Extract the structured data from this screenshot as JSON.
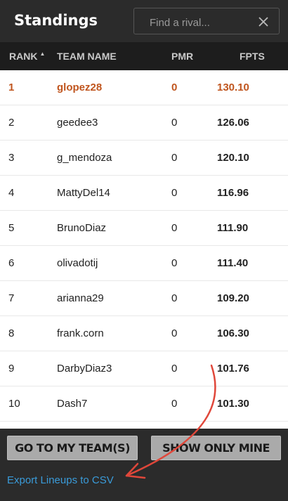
{
  "header": {
    "title": "Standings",
    "search_placeholder": "Find a rival..."
  },
  "columns": {
    "rank": "RANK",
    "team": "TEAM NAME",
    "pmr": "PMR",
    "fpts": "FPTS"
  },
  "rows": [
    {
      "rank": "1",
      "team": "glopez28",
      "pmr": "0",
      "fpts": "130.10",
      "highlight": true
    },
    {
      "rank": "2",
      "team": "geedee3",
      "pmr": "0",
      "fpts": "126.06"
    },
    {
      "rank": "3",
      "team": "g_mendoza",
      "pmr": "0",
      "fpts": "120.10"
    },
    {
      "rank": "4",
      "team": "MattyDel14",
      "pmr": "0",
      "fpts": "116.96"
    },
    {
      "rank": "5",
      "team": "BrunoDiaz",
      "pmr": "0",
      "fpts": "111.90"
    },
    {
      "rank": "6",
      "team": "olivadotij",
      "pmr": "0",
      "fpts": "111.40"
    },
    {
      "rank": "7",
      "team": "arianna29",
      "pmr": "0",
      "fpts": "109.20"
    },
    {
      "rank": "8",
      "team": "frank.corn",
      "pmr": "0",
      "fpts": "106.30"
    },
    {
      "rank": "9",
      "team": "DarbyDiaz3",
      "pmr": "0",
      "fpts": "101.76"
    },
    {
      "rank": "10",
      "team": "Dash7",
      "pmr": "0",
      "fpts": "101.30"
    }
  ],
  "footer": {
    "go_to_team_label": "GO TO MY TEAM(S)",
    "show_only_mine_label": "SHOW ONLY MINE",
    "export_label": "Export Lineups to CSV"
  },
  "colors": {
    "highlight": "#c0551e",
    "link": "#3a9bd9",
    "annotation_arrow": "#e0473a"
  }
}
